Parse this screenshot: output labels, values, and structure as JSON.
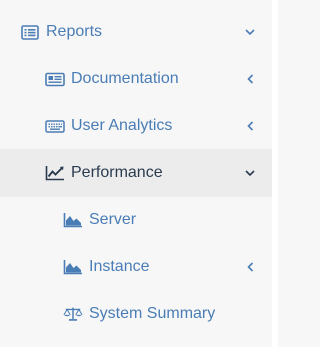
{
  "colors": {
    "link": "#4a7db5",
    "active_text": "#2a3b4f",
    "active_bg": "#ececec",
    "background": "#f7f7f7"
  },
  "menu": {
    "reports": {
      "label": "Reports",
      "icon": "list-alt-icon",
      "state": "expanded"
    },
    "documentation": {
      "label": "Documentation",
      "icon": "newspaper-icon",
      "state": "collapsed"
    },
    "user_analytics": {
      "label": "User Analytics",
      "icon": "keyboard-icon",
      "state": "collapsed"
    },
    "performance": {
      "label": "Performance",
      "icon": "line-chart-icon",
      "state": "expanded",
      "active": true
    },
    "server": {
      "label": "Server",
      "icon": "area-chart-icon"
    },
    "instance": {
      "label": "Instance",
      "icon": "area-chart-icon",
      "state": "collapsed"
    },
    "system_summary": {
      "label": "System Summary",
      "icon": "balance-scale-icon"
    }
  }
}
